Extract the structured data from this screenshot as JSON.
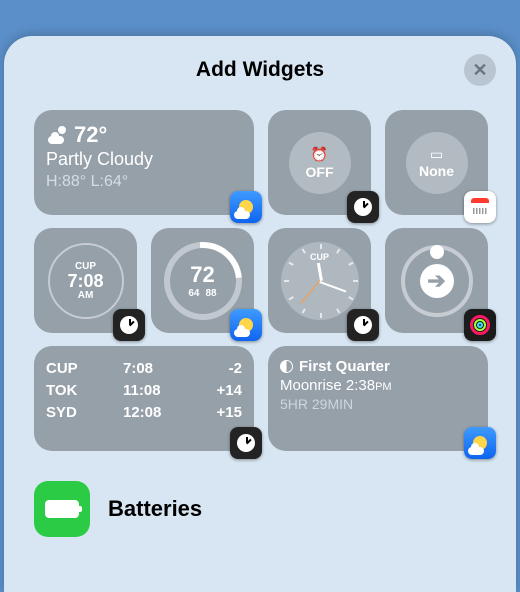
{
  "header": {
    "title": "Add Widgets"
  },
  "widgets": {
    "weather": {
      "temp": "72°",
      "condition": "Partly Cloudy",
      "hi_low": "H:88° L:64°"
    },
    "alarm": {
      "label": "OFF"
    },
    "calendar": {
      "label": "None"
    },
    "clock_digital": {
      "city": "CUP",
      "time": "7:08",
      "ampm": "AM"
    },
    "temp_gauge": {
      "temp": "72",
      "low": "64",
      "high": "88"
    },
    "clock_analog": {
      "city": "CUP"
    },
    "world_clocks": [
      {
        "city": "CUP",
        "time": "7:08",
        "offset": "-2"
      },
      {
        "city": "TOK",
        "time": "11:08",
        "offset": "+14"
      },
      {
        "city": "SYD",
        "time": "12:08",
        "offset": "+15"
      }
    ],
    "moon": {
      "phase": "First Quarter",
      "event_label": "Moonrise",
      "event_time": "2:38",
      "event_ampm": "PM",
      "countdown": "5HR 29MIN"
    }
  },
  "sections": {
    "batteries": {
      "label": "Batteries"
    }
  }
}
